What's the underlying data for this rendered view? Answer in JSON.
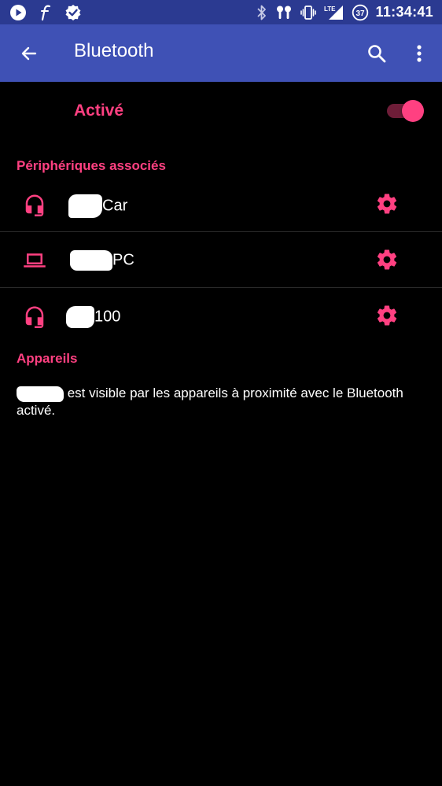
{
  "status_bar": {
    "time": "11:34:41",
    "battery_level": "37",
    "network_label": "LTE",
    "left_icons": [
      "play-circle-icon",
      "font-f-icon",
      "check-badge-icon"
    ],
    "right_icons": [
      "bluetooth-icon",
      "earbuds-icon",
      "vibrate-icon",
      "signal-lte-icon",
      "battery-icon"
    ]
  },
  "app_bar": {
    "title": "Bluetooth",
    "color": "#3f51b5"
  },
  "toggle": {
    "label": "Activé",
    "on": true,
    "accent_color": "#ff4081"
  },
  "paired_section": {
    "header": "Périphériques associés",
    "devices": [
      {
        "name_suffix": "Car",
        "icon": "headset-icon"
      },
      {
        "name_suffix": "PC",
        "icon": "laptop-icon"
      },
      {
        "name_suffix": "100",
        "icon": "headset-icon"
      }
    ]
  },
  "available_section": {
    "header": "Appareils",
    "visibility_text": " est visible par les appareils à proximité avec le Bluetooth activé."
  }
}
